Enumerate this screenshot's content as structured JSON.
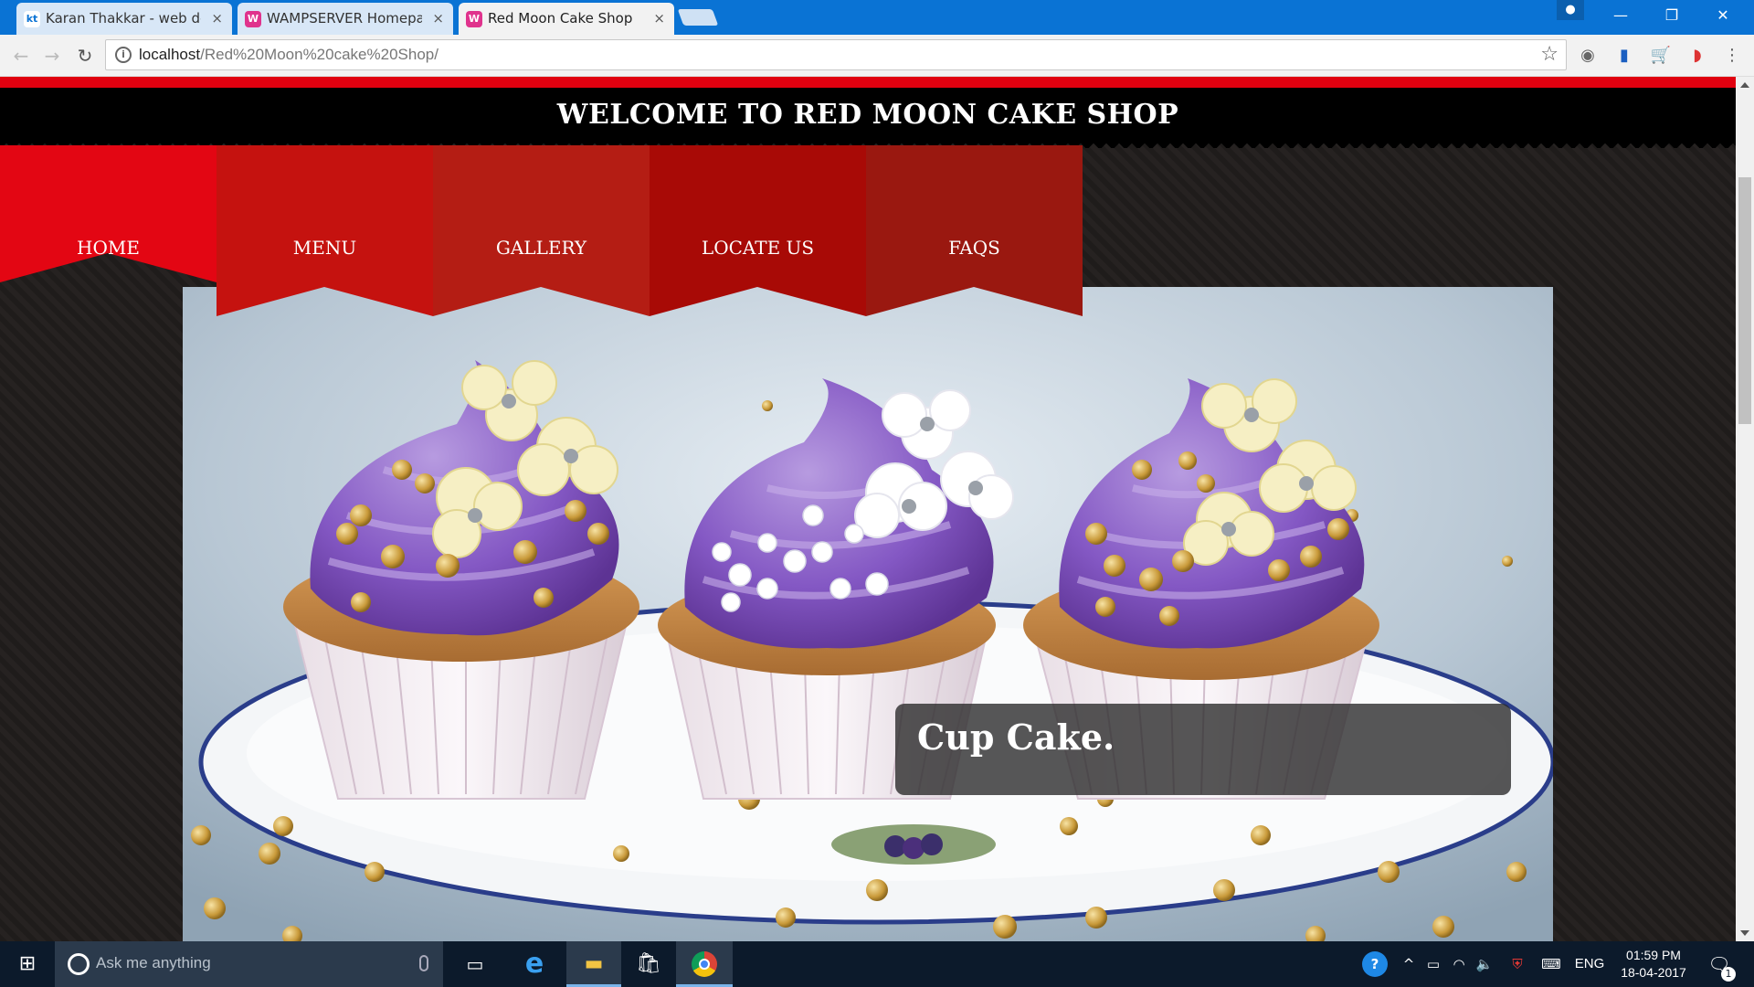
{
  "browser": {
    "tabs": [
      {
        "favicon": "kt",
        "title": "Karan Thakkar - web des",
        "close": "×",
        "active": false
      },
      {
        "favicon": "W",
        "title": "WAMPSERVER Homepag",
        "close": "×",
        "active": false
      },
      {
        "favicon": "W",
        "title": "Red Moon Cake Shop",
        "close": "×",
        "active": true
      }
    ],
    "url_host": "localhost",
    "url_path": "/Red%20Moon%20cake%20Shop/",
    "window_controls": {
      "minimize": "—",
      "restore": "❐",
      "close": "✕"
    }
  },
  "site": {
    "title": "WELCOME TO RED MOON CAKE SHOP",
    "nav": [
      "HOME",
      "MENU",
      "GALLERY",
      "LOCATE US",
      "FAQS"
    ],
    "caption": "Cup Cake."
  },
  "colors": {
    "nav_colors": [
      "#e30613",
      "#c5120f",
      "#b41d14",
      "#a80a06",
      "#9a1810"
    ],
    "header_bg": "#000000",
    "strip": "#e0000f"
  },
  "taskbar": {
    "search_placeholder": "Ask me anything",
    "language": "ENG",
    "time": "01:59 PM",
    "date": "18-04-2017",
    "notifications": "1"
  }
}
